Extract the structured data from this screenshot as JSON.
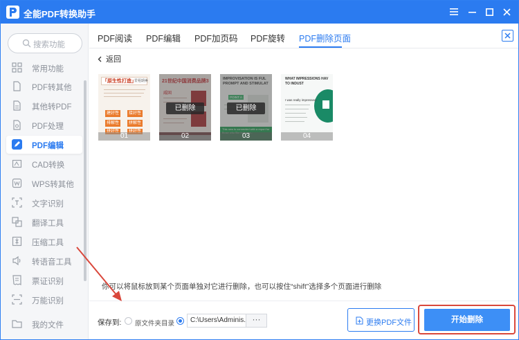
{
  "app": {
    "title": "全能PDF转换助手"
  },
  "sidebar": {
    "search_placeholder": "搜索功能",
    "items": [
      {
        "label": "常用功能"
      },
      {
        "label": "PDF转其他"
      },
      {
        "label": "其他转PDF"
      },
      {
        "label": "PDF处理"
      },
      {
        "label": "PDF编辑"
      },
      {
        "label": "CAD转换"
      },
      {
        "label": "WPS转其他"
      },
      {
        "label": "文字识别"
      },
      {
        "label": "翻译工具"
      },
      {
        "label": "压缩工具"
      },
      {
        "label": "转语音工具"
      },
      {
        "label": "票证识别"
      },
      {
        "label": "万能识别"
      },
      {
        "label": "我的文件"
      }
    ],
    "active_item": "PDF编辑"
  },
  "tabs": [
    {
      "label": "PDF阅读"
    },
    {
      "label": "PDF编辑"
    },
    {
      "label": "PDF加页码"
    },
    {
      "label": "PDF旋转"
    },
    {
      "label": "PDF删除页面"
    }
  ],
  "active_tab": "PDF删除页面",
  "back": {
    "label": "返回"
  },
  "pages": [
    {
      "number": "01",
      "deleted": false,
      "heading": "「原生性打造」",
      "heading2": "爱租期美",
      "buttons": [
        "建好性",
        "接好性",
        "排解性",
        "拼解性",
        "拼好性",
        "拼好性"
      ]
    },
    {
      "number": "02",
      "deleted": true,
      "heading": "21世纪中国消费品牌3",
      "badge": "已删除",
      "label": "威固"
    },
    {
      "number": "03",
      "deleted": true,
      "heading": "IMPROVISATION IS FUL PROMPT AND STIMULAT",
      "badge": "已删除",
      "tag": "POINT A",
      "footer": "This new is connected with a report for those who like to impro..."
    },
    {
      "number": "04",
      "deleted": false,
      "heading": "WHAT IMPRESSIONS HAV TO INDUST",
      "quote": "I was really impressed."
    }
  ],
  "hint": "你可以将鼠标放到某个页面单独对它进行删除，也可以按住“shift”选择多个页面进行删除",
  "save": {
    "label": "保存到:",
    "option_source": "原文件夹目录",
    "path": "C:\\Users\\Adminis...",
    "browse": "···"
  },
  "buttons": {
    "change_pdf": "更换PDF文件",
    "start_delete": "开始删除"
  },
  "colors": {
    "accent": "#2b7bf0",
    "highlight": "#d9473b"
  },
  "icons": {
    "title_logo": "pdf-logo-icon",
    "search": "search-icon",
    "close": "close-icon"
  }
}
